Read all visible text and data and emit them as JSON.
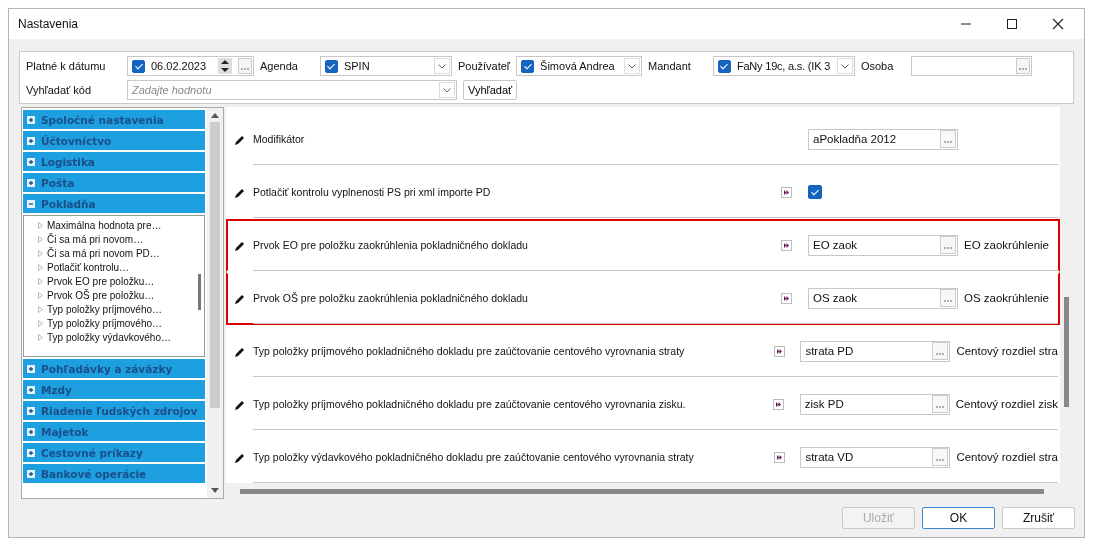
{
  "window": {
    "title": "Nastavenia"
  },
  "filters": {
    "fields": [
      {
        "kind": "date",
        "label": "Platné k dátumu",
        "checked": true,
        "value": "06.02.2023"
      },
      {
        "kind": "combo",
        "label": "Agenda",
        "checked": true,
        "value": "SPIN"
      },
      {
        "kind": "combo",
        "label": "Používateľ",
        "checked": true,
        "value": "Šimová Andrea"
      },
      {
        "kind": "combo",
        "label": "Mandant",
        "checked": true,
        "value": "FaNy 19c, a.s. (IK 3"
      },
      {
        "kind": "lookup",
        "label": "Osoba"
      }
    ],
    "search": {
      "label": "Vyhľadať kód",
      "placeholder": "Zadajte hodnotu",
      "button": "Vyhľadať"
    }
  },
  "sidebar": {
    "items": [
      {
        "label": "Spoločné nastavenia",
        "expanded": false
      },
      {
        "label": "Účtovníctvo",
        "expanded": false
      },
      {
        "label": "Logistika",
        "expanded": false
      },
      {
        "label": "Pošta",
        "expanded": false
      },
      {
        "label": "Pokladňa",
        "expanded": true,
        "children": [
          "Maximálna hodnota pre…",
          "Či sa má pri novom…",
          "Či sa má pri novom PD…",
          "Potlačiť kontrolu…",
          "Prvok EO pre položku…",
          "Prvok OŠ pre položku…",
          "Typ položky príjmového…",
          "Typ položky príjmového…",
          "Typ položky výdavkového…"
        ]
      },
      {
        "label": "Pohľadávky a záväzky",
        "expanded": false
      },
      {
        "label": "Mzdy",
        "expanded": false
      },
      {
        "label": "Riadenie ľudských zdrojov",
        "expanded": false
      },
      {
        "label": "Majetok",
        "expanded": false
      },
      {
        "label": "Cestovné príkazy",
        "expanded": false
      },
      {
        "label": "Bankové operácie",
        "expanded": false
      }
    ]
  },
  "settings": [
    {
      "kind": "lookup",
      "label": "Modifikátor",
      "action": false,
      "value": "aPokladňa 2012",
      "highlighted": false
    },
    {
      "kind": "checkbox",
      "label": "Potlačiť kontrolu vyplnenosti PS pri xml importe PD",
      "action": true,
      "checked": true,
      "highlighted": false
    },
    {
      "kind": "lookup",
      "label": "Prvok EO pre položku zaokrúhlenia pokladničného dokladu",
      "action": true,
      "value": "EO zaok",
      "description": "EO zaokrúhlenie",
      "highlighted": true
    },
    {
      "kind": "lookup",
      "label": "Prvok OŠ pre položku zaokrúhlenia pokladničného dokladu",
      "action": true,
      "value": "OS zaok",
      "description": "OS zaokrúhlenie",
      "highlighted": true
    },
    {
      "kind": "lookup",
      "label": "Typ položky príjmového pokladničného dokladu pre zaúčtovanie centového vyrovnania straty",
      "action": true,
      "value": "strata PD",
      "description": "Centový rozdiel stra",
      "highlighted": false
    },
    {
      "kind": "lookup",
      "label": "Typ položky príjmového pokladničného dokladu pre zaúčtovanie centového vyrovnania zisku.",
      "action": true,
      "value": "zisk PD",
      "description": "Centový rozdiel zisk",
      "highlighted": false
    },
    {
      "kind": "lookup",
      "label": "Typ položky výdavkového pokladničného dokladu pre zaúčtovanie centového vyrovnania straty",
      "action": true,
      "value": "strata VD",
      "description": "Centový rozdiel stra",
      "highlighted": false
    }
  ],
  "buttons": [
    {
      "label": "Uložiť",
      "disabled": true,
      "default": false
    },
    {
      "label": "OK",
      "disabled": false,
      "default": true
    },
    {
      "label": "Zrušiť",
      "disabled": false,
      "default": false
    }
  ]
}
